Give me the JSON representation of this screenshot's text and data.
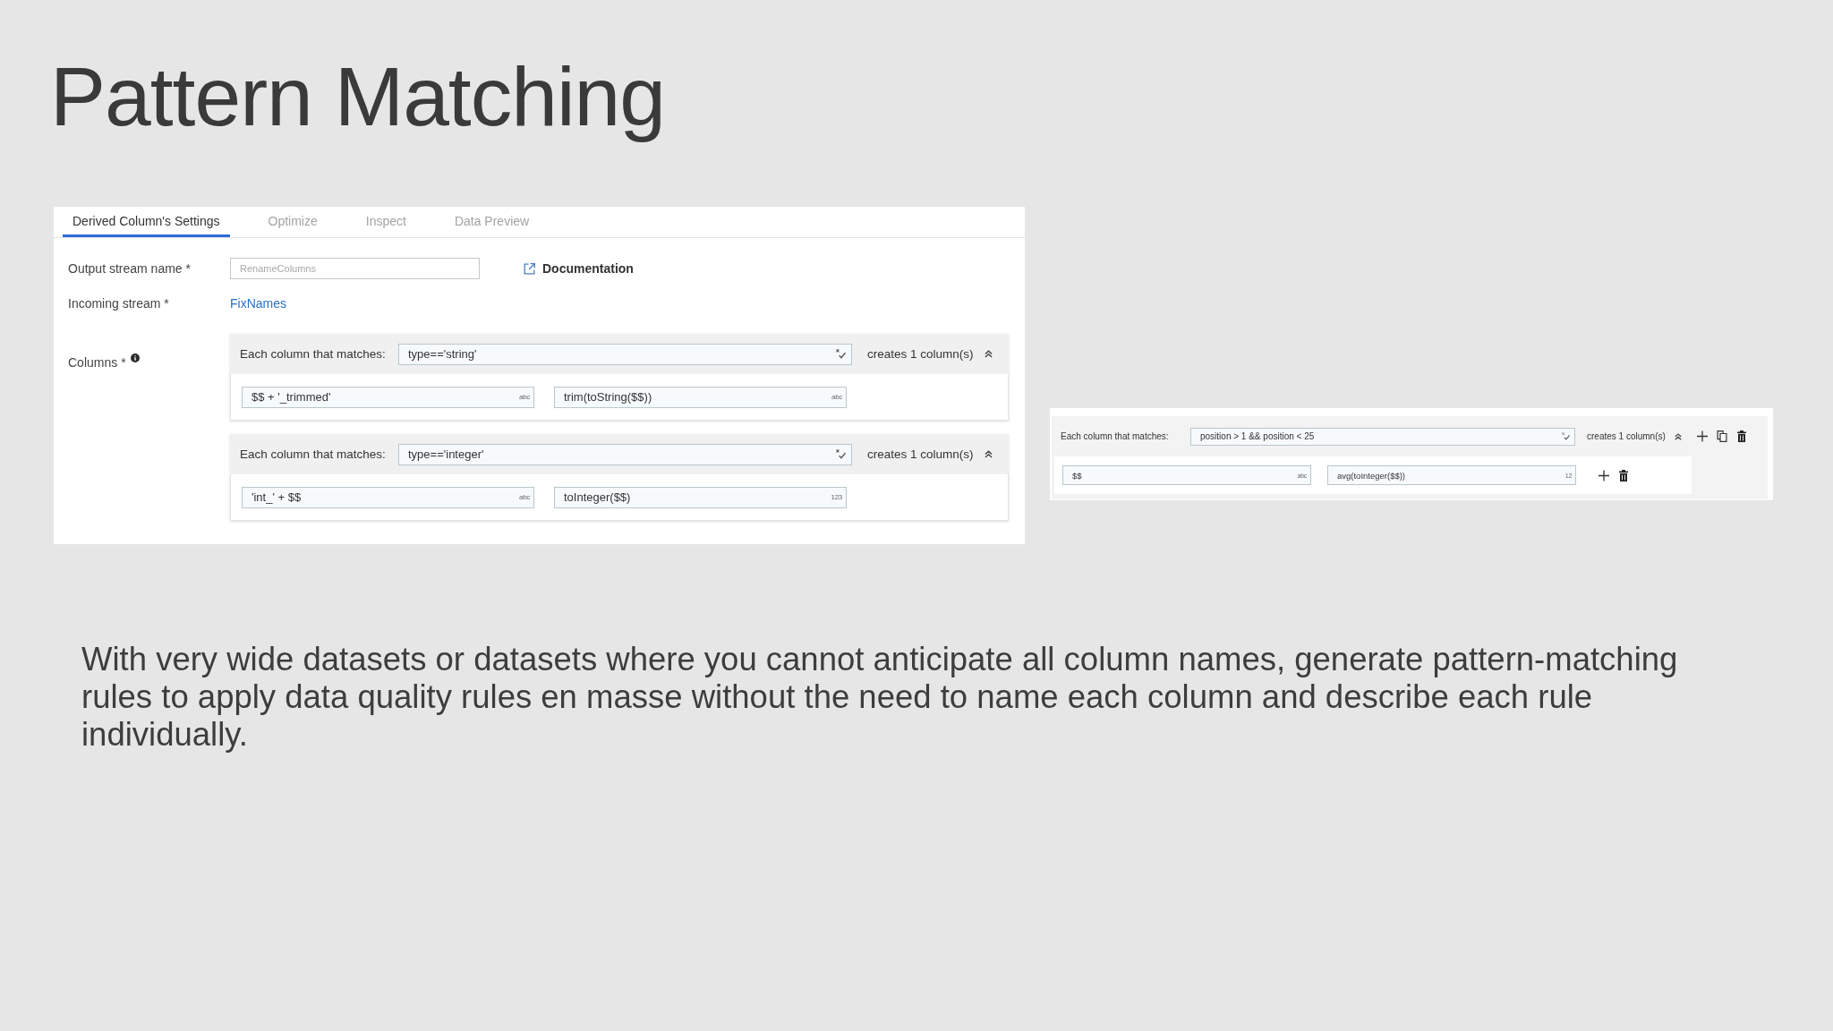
{
  "title": "Pattern Matching",
  "settings_panel": {
    "tabs": [
      {
        "label": "Derived Column's Settings",
        "selected": true
      },
      {
        "label": "Optimize",
        "selected": false
      },
      {
        "label": "Inspect",
        "selected": false
      },
      {
        "label": "Data Preview",
        "selected": false
      }
    ],
    "output_stream_name": {
      "label": "Output stream name *",
      "value": "RenameColumns"
    },
    "documentation_link": "Documentation",
    "incoming_stream": {
      "label": "Incoming stream *",
      "value": "FixNames"
    },
    "columns_label": "Columns *",
    "rules": [
      {
        "match_label": "Each column that matches:",
        "condition": "type=='string'",
        "creates": "creates 1 column(s)",
        "columns": [
          {
            "name": "$$ + '_trimmed'",
            "name_type": "abc",
            "expression": "trim(toString($$))",
            "expression_type": "abc"
          }
        ]
      },
      {
        "match_label": "Each column that matches:",
        "condition": "type=='integer'",
        "creates": "creates 1 column(s)",
        "columns": [
          {
            "name": "'int_' + $$",
            "name_type": "abc",
            "expression": "toInteger($$)",
            "expression_type": "123"
          }
        ]
      }
    ]
  },
  "pattern_panel": {
    "rules": [
      {
        "match_label": "Each column that matches:",
        "condition": "position > 1 && position < 25",
        "creates": "creates 1 column(s)",
        "columns": [
          {
            "name": "$$",
            "name_type": "abc",
            "expression": "avg(toInteger($$))",
            "expression_type": "12"
          }
        ]
      }
    ]
  },
  "description": "With very wide datasets or datasets where you cannot anticipate all column names, generate pattern-matching rules to apply data quality rules en masse without the need to name each column and describe each rule individually."
}
